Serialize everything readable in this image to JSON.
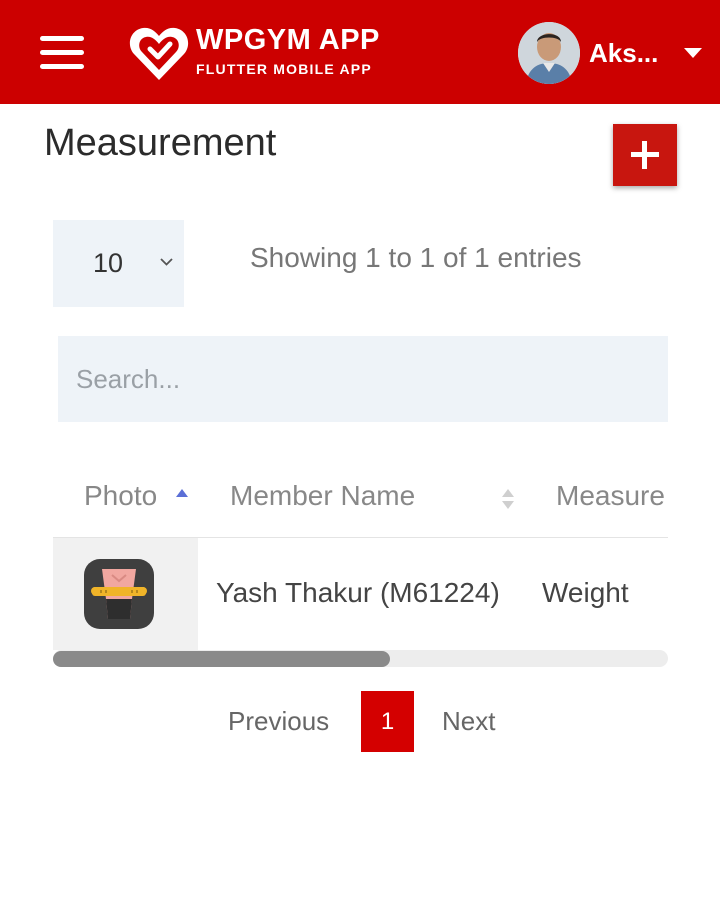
{
  "header": {
    "brand_title": "WPGYM APP",
    "brand_subtitle": "FLUTTER MOBILE APP",
    "user_name": "Aks...",
    "menu_icon": "hamburger-menu-icon",
    "caret_icon": "caret-down-icon",
    "background_color": "#cc0000"
  },
  "page": {
    "title": "Measurement",
    "add_icon": "plus-icon"
  },
  "controls": {
    "page_length": "10",
    "entries_info": "Showing 1 to 1 of 1 entries",
    "search_placeholder": "Search..."
  },
  "table": {
    "columns": [
      "Photo",
      "Member Name",
      "Measure"
    ],
    "rows": [
      {
        "photo_icon": "measuring-tape-waist-icon",
        "member_name": "Yash Thakur (M61224)",
        "measurement": "Weight"
      }
    ]
  },
  "pagination": {
    "previous": "Previous",
    "current_page": "1",
    "next": "Next",
    "accent_color": "#d40000"
  },
  "scroll": {
    "thumb_fraction": 0.55
  }
}
